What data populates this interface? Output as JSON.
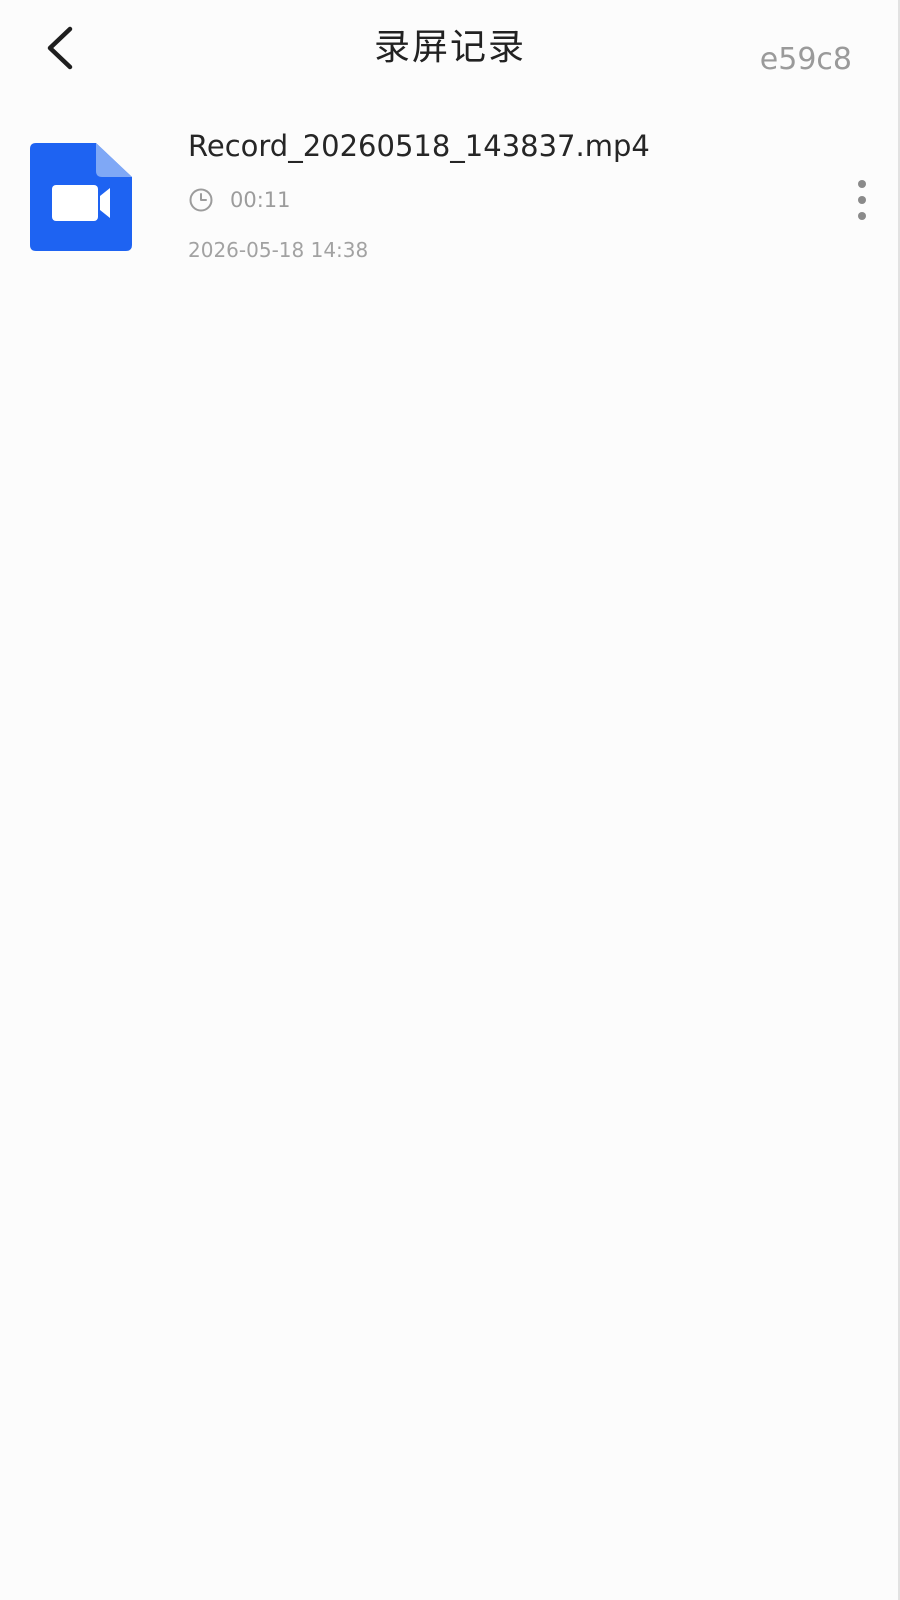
{
  "header": {
    "title": "录屏记录",
    "corner_tag": "e59c8",
    "back_icon": "chevron-left-icon"
  },
  "records": [
    {
      "file_name": "Record_20260518_143837.mp4",
      "duration": "00:11",
      "date": "2026-05-18 14:38",
      "file_icon": "video-file-icon",
      "duration_icon": "clock-icon",
      "menu_icon": "more-vertical-icon"
    }
  ],
  "colors": {
    "background": "#fcfcfc",
    "file_icon_blue": "#1e63f2",
    "file_icon_fold": "#7fa8f6",
    "primary_text": "#262626",
    "secondary_text": "#9c9c9c"
  }
}
